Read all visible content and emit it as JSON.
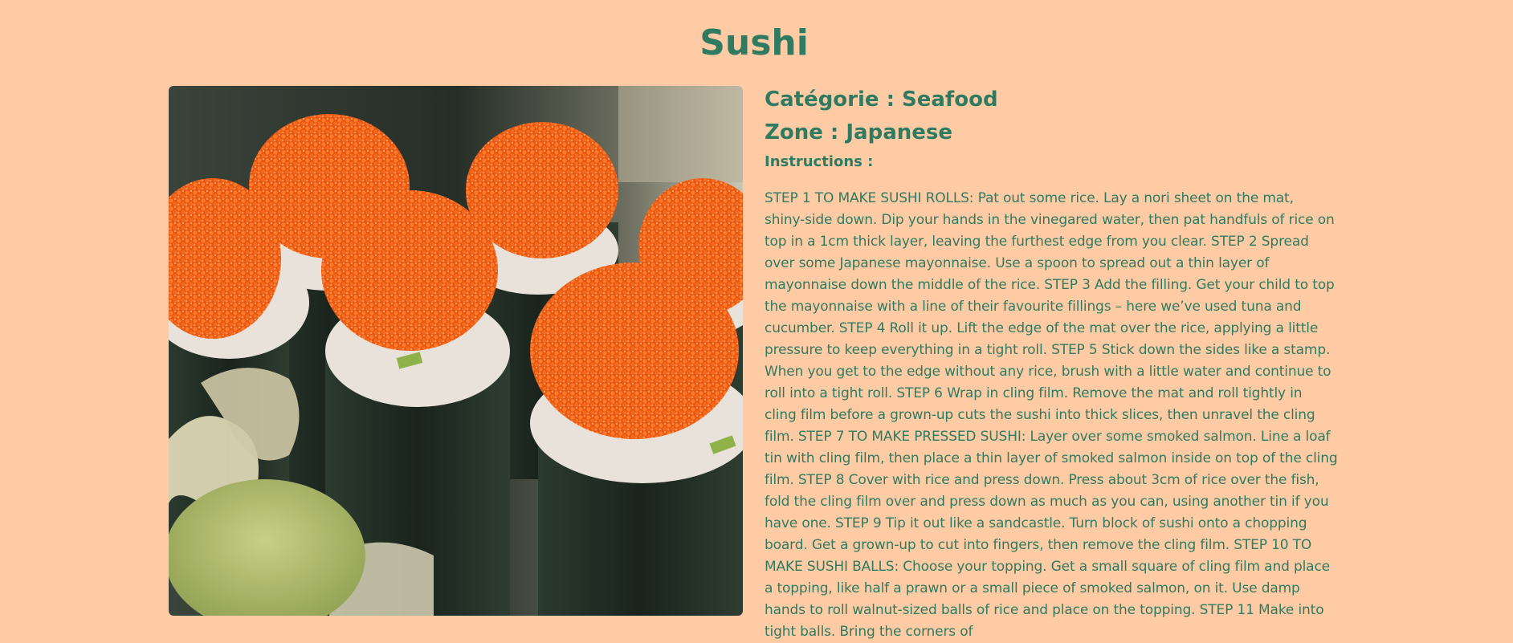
{
  "meal": {
    "title": "Sushi",
    "category": "Catégorie : Seafood",
    "zone": "Zone : Japanese",
    "instructions_label": "Instructions :",
    "instructions": "STEP 1 TO MAKE SUSHI ROLLS: Pat out some rice. Lay a nori sheet on the mat, shiny-side down. Dip your hands in the vinegared water, then pat handfuls of rice on top in a 1cm thick layer, leaving the furthest edge from you clear. STEP 2 Spread over some Japanese mayonnaise. Use a spoon to spread out a thin layer of mayonnaise down the middle of the rice. STEP 3 Add the filling. Get your child to top the mayonnaise with a line of their favourite fillings – here we’ve used tuna and cucumber. STEP 4 Roll it up. Lift the edge of the mat over the rice, applying a little pressure to keep everything in a tight roll. STEP 5 Stick down the sides like a stamp. When you get to the edge without any rice, brush with a little water and continue to roll into a tight roll. STEP 6 Wrap in cling film. Remove the mat and roll tightly in cling film before a grown-up cuts the sushi into thick slices, then unravel the cling film. STEP 7 TO MAKE PRESSED SUSHI: Layer over some smoked salmon. Line a loaf tin with cling film, then place a thin layer of smoked salmon inside on top of the cling film. STEP 8 Cover with rice and press down. Press about 3cm of rice over the fish, fold the cling film over and press down as much as you can, using another tin if you have one. STEP 9 Tip it out like a sandcastle. Turn block of sushi onto a chopping board. Get a grown-up to cut into fingers, then remove the cling film. STEP 10 TO MAKE SUSHI BALLS: Choose your topping. Get a small square of cling film and place a topping, like half a prawn or a small piece of smoked salmon, on it. Use damp hands to roll walnut-sized balls of rice and place on the topping. STEP 11 Make into tight balls. Bring the corners of"
  },
  "colors": {
    "background": "#FFCBA4",
    "text": "#2E7B62",
    "roe": "#F0651A",
    "nori": "#1E2A22",
    "rice": "#E8E2DA",
    "wasabi": "#B7C06E",
    "ginger": "#DCD6B4"
  },
  "image": {
    "icon": "sushi-photo",
    "subject": "sushi rolls with orange fish roe"
  }
}
